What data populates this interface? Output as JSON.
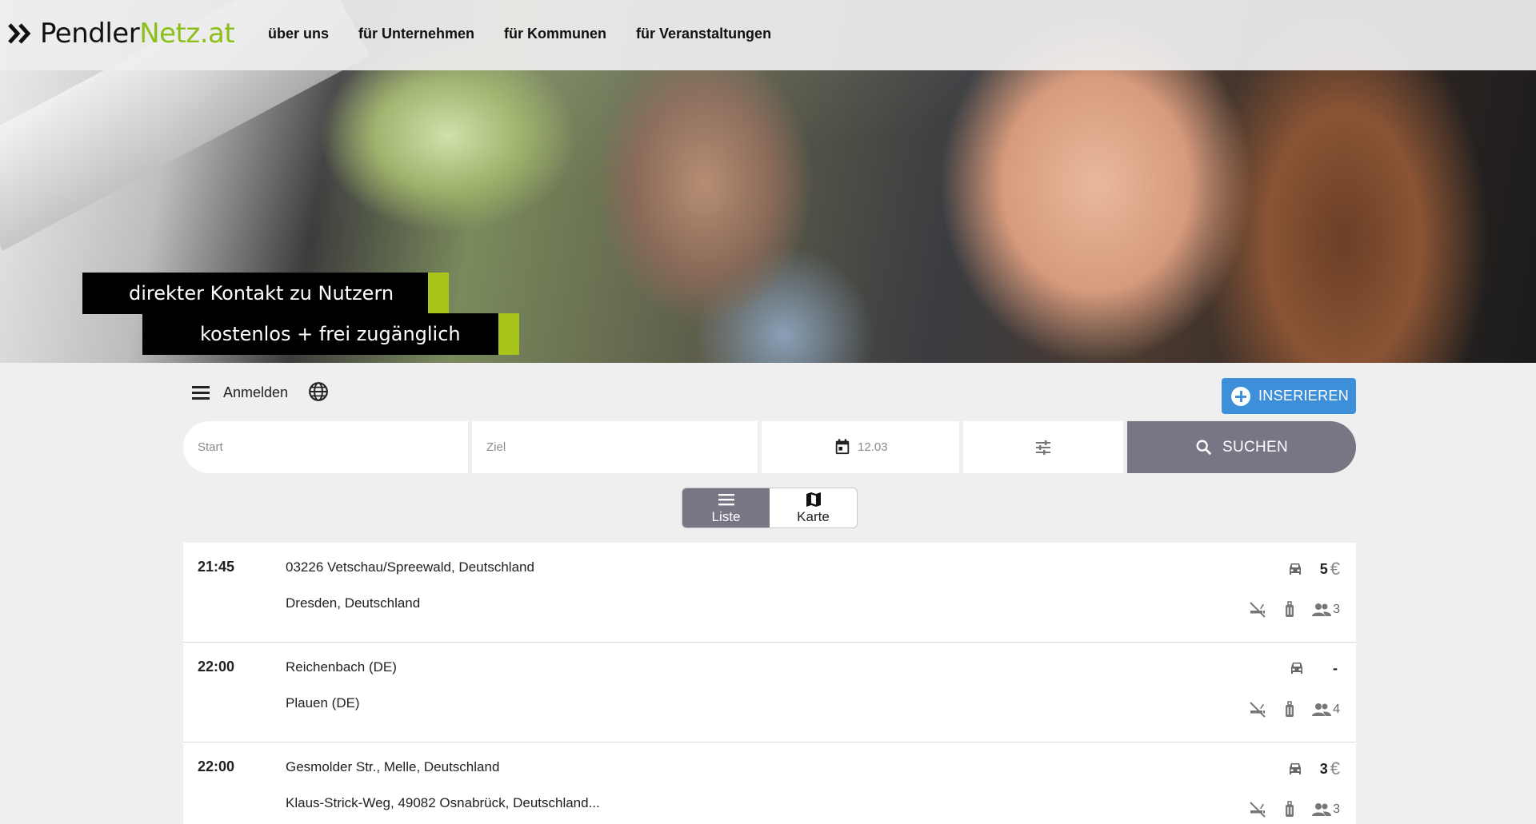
{
  "header": {
    "logo_part1": "Pendler",
    "logo_part2": "Netz.at",
    "nav": [
      "über uns",
      "für Unternehmen",
      "für Kommunen",
      "für Veranstaltungen"
    ]
  },
  "hero": {
    "badge1": "direkter Kontakt zu Nutzern",
    "badge2": "kostenlos + frei zugänglich"
  },
  "controls": {
    "login_label": "Anmelden",
    "post_label": "INSERIEREN"
  },
  "search": {
    "start_placeholder": "Start",
    "ziel_placeholder": "Ziel",
    "date_value": "12.03",
    "search_label": "SUCHEN"
  },
  "view_toggle": {
    "list_label": "Liste",
    "map_label": "Karte",
    "active": "list"
  },
  "rides": [
    {
      "time": "21:45",
      "from": "03226 Vetschau/Spreewald, Deutschland",
      "to": "Dresden, Deutschland",
      "price": "5",
      "currency": "€",
      "seats": "3"
    },
    {
      "time": "22:00",
      "from": "Reichenbach (DE)",
      "to": "Plauen (DE)",
      "price": "-",
      "currency": "",
      "seats": "4"
    },
    {
      "time": "22:00",
      "from": "Gesmolder Str., Melle, Deutschland",
      "to": "Klaus-Strick-Weg, 49082 Osnabrück, Deutschland...",
      "price": "3",
      "currency": "€",
      "seats": "3"
    }
  ],
  "colors": {
    "brand_green": "#8cbf1a",
    "badge_bar": "#a9c51b",
    "primary_blue": "#3c8fd8",
    "search_gray": "#7a7585"
  }
}
